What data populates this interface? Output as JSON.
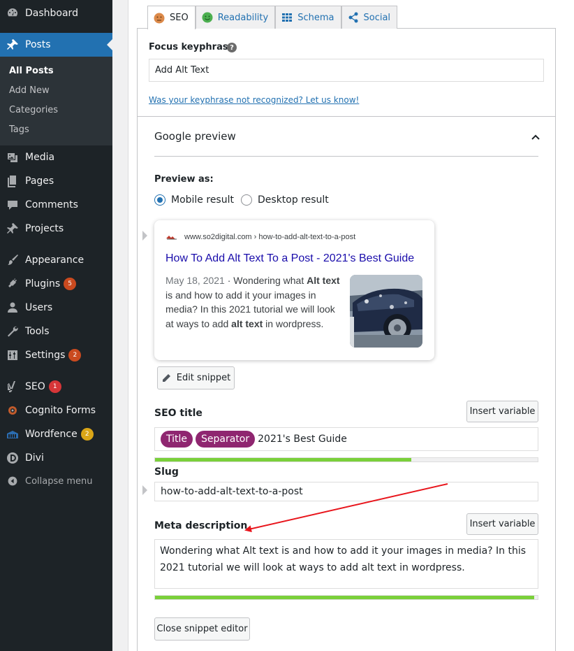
{
  "sidebar": {
    "dashboard": "Dashboard",
    "posts": "Posts",
    "sub": [
      "All Posts",
      "Add New",
      "Categories",
      "Tags"
    ],
    "media": "Media",
    "pages": "Pages",
    "comments": "Comments",
    "projects": "Projects",
    "appearance": "Appearance",
    "plugins": "Plugins",
    "plugins_badge": "5",
    "users": "Users",
    "tools": "Tools",
    "settings": "Settings",
    "settings_badge": "2",
    "seo": "SEO",
    "seo_badge": "1",
    "cognito": "Cognito Forms",
    "wordfence": "Wordfence",
    "wordfence_badge": "2",
    "divi": "Divi",
    "collapse": "Collapse menu"
  },
  "tabs": [
    "SEO",
    "Readability",
    "Schema",
    "Social"
  ],
  "focus": {
    "label": "Focus keyphrase",
    "help": "?",
    "value": "Add Alt Text",
    "link": "Was your keyphrase not recognized? Let us know!"
  },
  "google_preview": {
    "title": "Google preview",
    "preview_as": "Preview as:",
    "mobile": "Mobile result",
    "desktop": "Desktop result",
    "serp": {
      "url": "www.so2digital.com › how-to-add-alt-text-to-a-post",
      "title": "How To Add Alt Text To a Post - 2021's Best Guide",
      "date": "May 18, 2021",
      "sep": " · ",
      "d1": "Wondering what ",
      "b1": "Alt text",
      "d2": " is and how to add it your images in media? In this 2021 tutorial we will look at ways to add ",
      "b2": "alt text",
      "d3": " in wordpress."
    },
    "edit_snippet": "Edit snippet"
  },
  "seo_title": {
    "label": "SEO title",
    "insert": "Insert variable",
    "pill1": "Title",
    "pill2": "Separator",
    "text": "2021's Best Guide",
    "progress": 0.67
  },
  "slug": {
    "label": "Slug",
    "value": "how-to-add-alt-text-to-a-post"
  },
  "meta": {
    "label": "Meta description",
    "insert": "Insert variable",
    "value": "Wondering what Alt text is and how to add it your images in media? In this 2021 tutorial we will look at ways to add alt text in wordpress.",
    "progress": 0.99
  },
  "close_editor": "Close snippet editor",
  "colors": {
    "accent": "#2271b1",
    "pill": "#8f2670",
    "progress_good": "#7ad03a",
    "annotation_arrow": "#e8141b"
  }
}
